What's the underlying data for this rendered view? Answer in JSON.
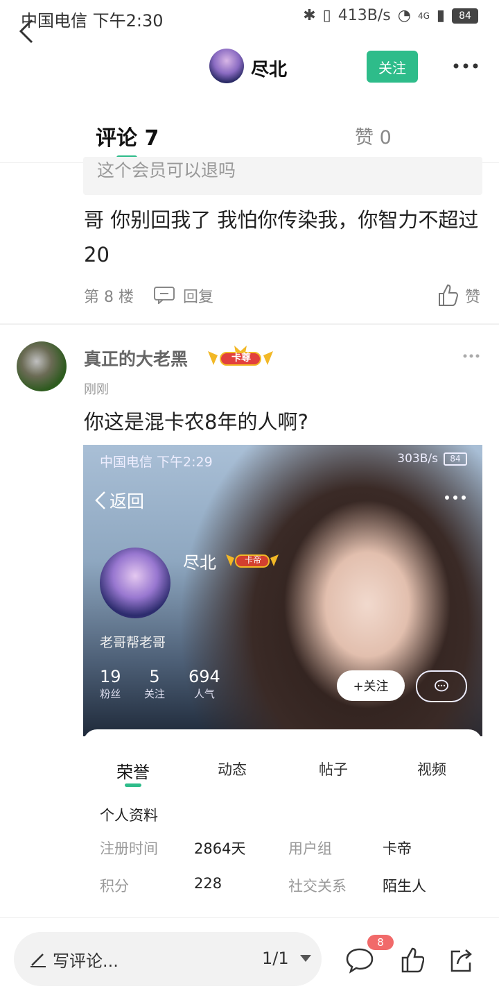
{
  "status_bar": {
    "carrier_time": "中国电信 下午2:30",
    "net_speed": "413B/s",
    "network": "4G",
    "battery": "84"
  },
  "header": {
    "title": "尽北",
    "follow_label": "关注"
  },
  "tabs": {
    "comments": "评论 7",
    "likes": "赞 0"
  },
  "comment1": {
    "quote": "这个会员可以退吗",
    "text": "哥 你别回我了 我怕你传染我，你智力不超过20",
    "floor": "第 8 楼",
    "reply_label": "回复",
    "like_label": "赞"
  },
  "comment2": {
    "username": "真正的大老黑",
    "badge": "卡尊",
    "time": "刚刚",
    "text": "你这是混卡农8年的人啊?"
  },
  "embedded_screenshot": {
    "status_left": "中国电信 下午2:29",
    "status_speed": "303B/s",
    "status_battery": "84",
    "back_label": "返回",
    "name": "尽北",
    "badge": "卡帝",
    "bio": "老哥帮老哥",
    "stats": [
      {
        "num": "19",
        "label": "粉丝"
      },
      {
        "num": "5",
        "label": "关注"
      },
      {
        "num": "694",
        "label": "人气"
      }
    ],
    "follow_label": "+关注",
    "tabs": [
      "荣誉",
      "动态",
      "帖子",
      "视频"
    ],
    "section_title": "个人资料",
    "fields": [
      {
        "label": "注册时间",
        "value": "2864天"
      },
      {
        "label": "用户组",
        "value": "卡帝"
      },
      {
        "label": "积分",
        "value": "228"
      },
      {
        "label": "社交关系",
        "value": "陌生人"
      }
    ]
  },
  "bottom_bar": {
    "input_placeholder": "写评论...",
    "page": "1/1",
    "comment_count": "8"
  },
  "colors": {
    "accent": "#2ebc8a",
    "badge_red": "#f16a6a"
  }
}
